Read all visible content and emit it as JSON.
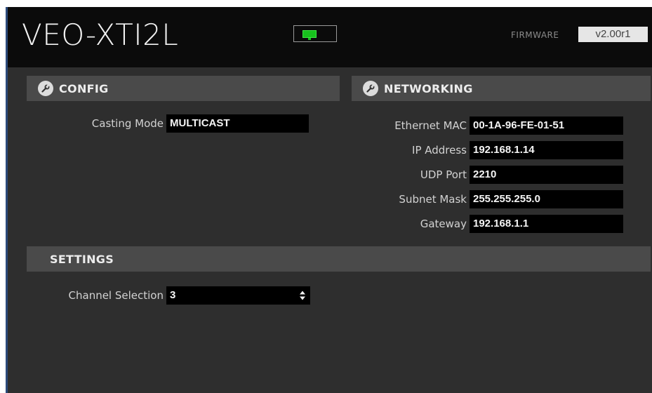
{
  "header": {
    "device_name": "VEO-XTI2L",
    "status_icon": "network-status-icon",
    "status_color": "#17c21d",
    "firmware_label": "FIRMWARE",
    "firmware_version": "v2.00r1"
  },
  "config": {
    "title": "CONFIG",
    "icon": "wrench-icon",
    "casting_mode_label": "Casting Mode",
    "casting_mode_value": "MULTICAST"
  },
  "networking": {
    "title": "NETWORKING",
    "icon": "wrench-icon",
    "fields": [
      {
        "label": "Ethernet MAC",
        "value": "00-1A-96-FE-01-51"
      },
      {
        "label": "IP Address",
        "value": "192.168.1.14"
      },
      {
        "label": "UDP Port",
        "value": "2210"
      },
      {
        "label": "Subnet Mask",
        "value": "255.255.255.0"
      },
      {
        "label": "Gateway",
        "value": "192.168.1.1"
      }
    ]
  },
  "settings": {
    "title": "SETTINGS",
    "channel_label": "Channel Selection",
    "channel_value": "3"
  }
}
